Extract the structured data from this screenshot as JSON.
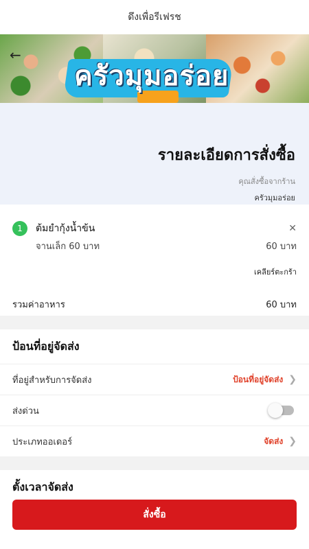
{
  "pull_to_refresh": "ดึงเพื่อรีเฟรช",
  "banner": {
    "logo_text": "ครัวมุมอร่อย"
  },
  "header": {
    "title": "รายละเอียดการสั่งซื้อ",
    "ordered_from_label": "คุณสั่งซื้อจากร้าน",
    "store_name": "ครัวมุมอร่อย"
  },
  "order": {
    "items": [
      {
        "qty": "1",
        "name": "ต้มยำกุ้งน้ำข้น",
        "size_price": "จานเล็ก 60 บาท",
        "line_total": "60 บาท"
      }
    ],
    "clear_cart": "เคลียร์ตะกร้า",
    "total_label": "รวมค่าอาหาร",
    "total_value": "60 บาท"
  },
  "delivery": {
    "section_title": "ป้อนที่อยู่จัดส่ง",
    "address_label": "ที่อยู่สำหรับการจัดส่ง",
    "address_value": "ป้อนที่อยู่จัดส่ง",
    "express_label": "ส่งด่วน",
    "express_on": false,
    "order_type_label": "ประเภทออเดอร์",
    "order_type_value": "จัดส่ง"
  },
  "schedule": {
    "section_title": "ตั้งเวลาจัดส่ง"
  },
  "submit": {
    "label": "สั่งซื้อ"
  },
  "colors": {
    "accent_red": "#d7191c",
    "value_red": "#e0432c",
    "badge_green": "#35c15b"
  }
}
